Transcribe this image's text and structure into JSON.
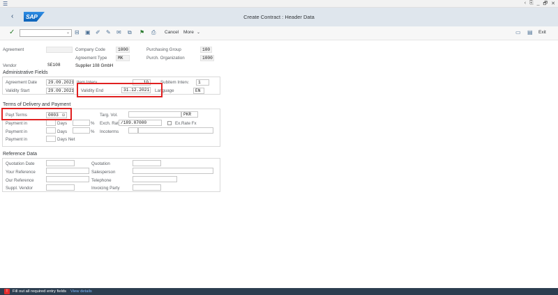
{
  "window": {
    "controls": [
      "‹",
      "⎘",
      "_",
      "🗗",
      "✕"
    ]
  },
  "shell": {
    "logo": "SAP",
    "title": "Create Contract : Header Data"
  },
  "toolbar": {
    "cancel_label": "Cancel",
    "more_label": "More",
    "exit_label": "Exit"
  },
  "header": {
    "agreement_label": "Agreement",
    "company_code_label": "Company Code",
    "company_code_value": "1000",
    "purch_group_label": "Purchasing Group",
    "purch_group_value": "100",
    "agreement_type_label": "Agreement Type",
    "agreement_type_value": "MK",
    "purch_org_label": "Purch. Organization",
    "purch_org_value": "1000",
    "vendor_label": "Vendor",
    "vendor_value": "SE108",
    "vendor_name": "Supplier 108 GmbH"
  },
  "admin": {
    "title": "Administrative Fields",
    "agreement_date_label": "Agreement Date",
    "agreement_date_value": "29.09.2021",
    "item_interv_label": "Item Interv.",
    "item_interv_value": "10",
    "subitem_interv_label": "Subitem Interv.",
    "subitem_interv_value": "1",
    "validity_start_label": "Validity Start",
    "validity_start_value": "29.09.2021",
    "validity_end_label": "Validity End",
    "validity_end_value": "31.12.2021",
    "language_label": "Language",
    "language_value": "EN"
  },
  "terms": {
    "title": "Terms of Delivery and Payment",
    "payt_terms_label": "Payt Terms",
    "payt_terms_value": "0003",
    "targ_vol_label": "Targ. Vol.",
    "targ_vol_currency": "PKR",
    "payment_in_label": "Payment in",
    "days_label": "Days",
    "days_net_label": "Days Net",
    "percent_label": "%",
    "exch_rate_label": "Exch. Rate",
    "exch_rate_value": "/189.07000",
    "ex_rate_fx_label": "Ex.Rate Fx",
    "incoterms_label": "Incoterms"
  },
  "reference": {
    "title": "Reference Data",
    "quotation_date_label": "Quotation Date",
    "quotation_label": "Quotation",
    "your_reference_label": "Your Reference",
    "salesperson_label": "Salesperson",
    "our_reference_label": "Our Reference",
    "telephone_label": "Telephone",
    "suppl_vendor_label": "Suppl. Vendor",
    "invoicing_party_label": "Invoicing Party"
  },
  "status": {
    "message": "Fill out all required entry fields",
    "link": "View details"
  },
  "colors": {
    "shell_bg": "#dfe6ed",
    "status_bg": "#2c3e50",
    "highlight": "#e02020",
    "error": "#e52d2d"
  }
}
